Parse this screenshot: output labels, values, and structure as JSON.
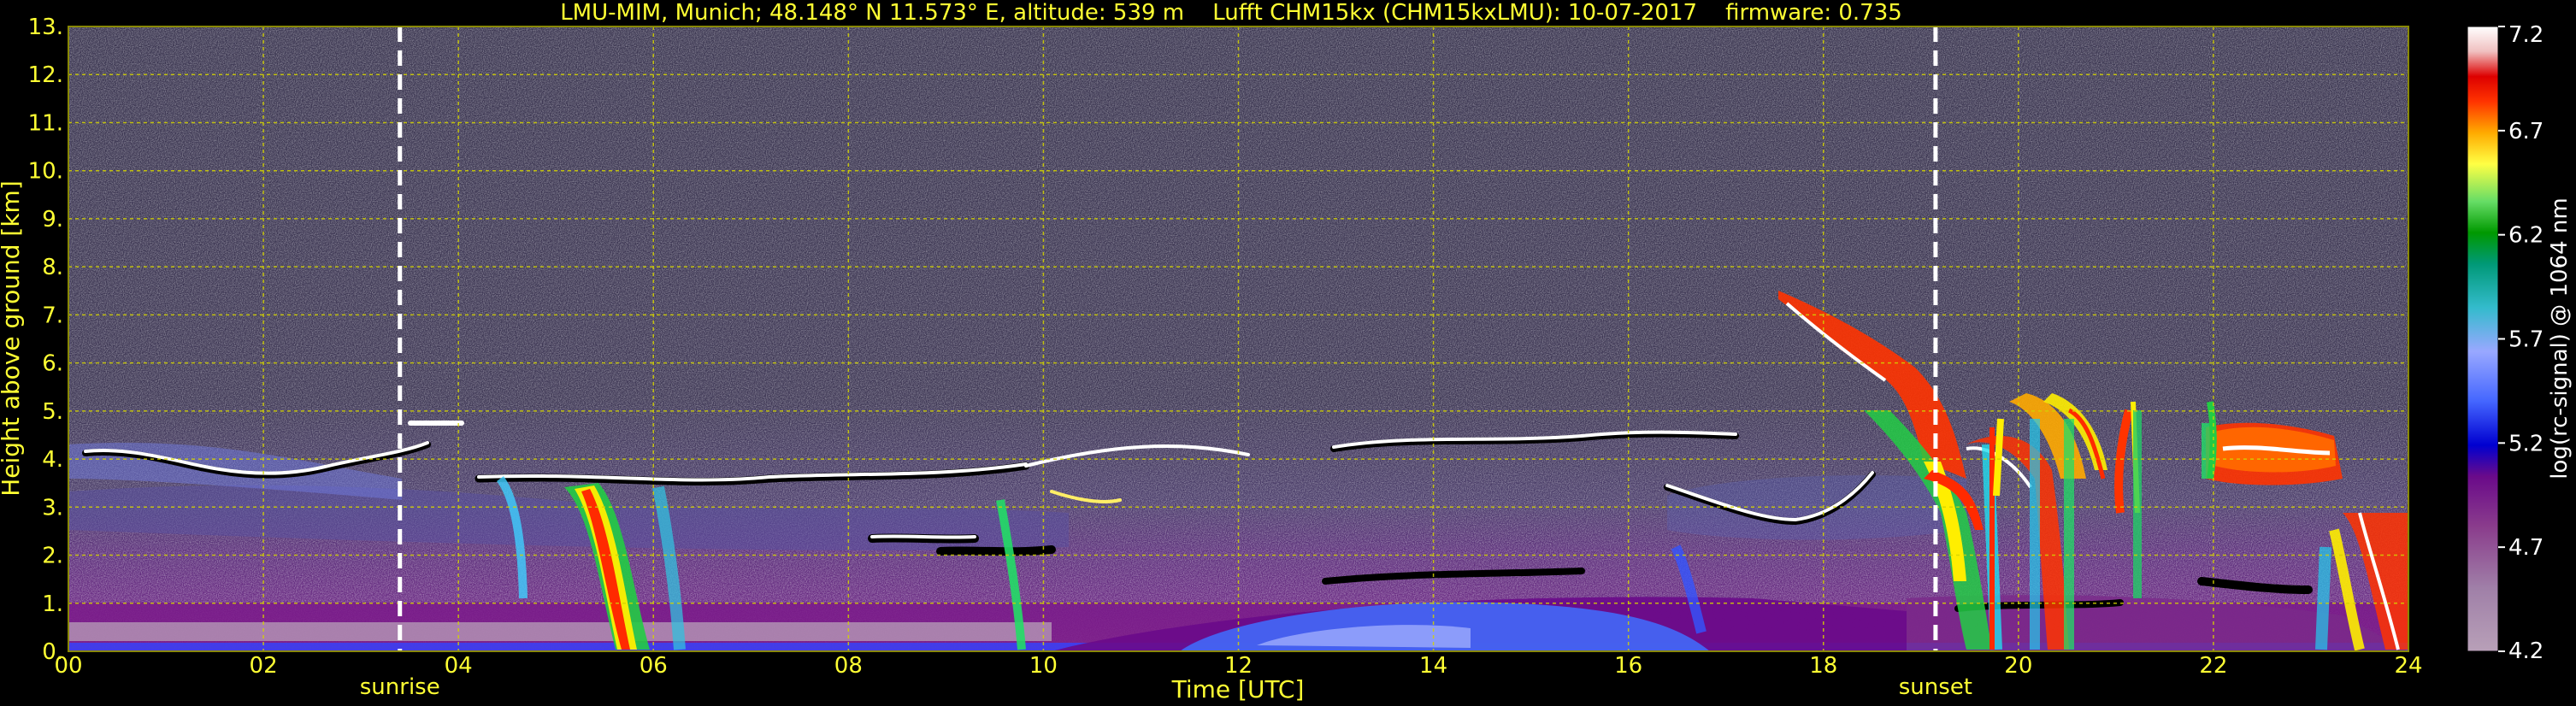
{
  "chart_data": {
    "type": "heatmap",
    "title": "LMU-MIM, Munich; 48.148° N 11.573° E, altitude: 539 m    Lufft CHM15kx (CHM15kxLMU): 10-07-2017    firmware: 0.735",
    "xlabel": "Time [UTC]",
    "ylabel": "Height above ground [km]",
    "xlim": [
      0,
      24
    ],
    "ylim": [
      0,
      13
    ],
    "x_ticks": [
      "00",
      "02",
      "04",
      "06",
      "08",
      "10",
      "12",
      "14",
      "16",
      "18",
      "20",
      "22",
      "24"
    ],
    "y_ticks": [
      "0.",
      "1.",
      "2.",
      "3.",
      "4.",
      "5.",
      "6.",
      "7.",
      "8.",
      "9.",
      "10.",
      "11.",
      "12.",
      "13."
    ],
    "grid": true,
    "events": [
      {
        "label": "sunrise",
        "time": 3.4
      },
      {
        "label": "sunset",
        "time": 19.15
      }
    ],
    "colorbar": {
      "label": "log(rc-signal) @ 1064 nm",
      "range": [
        4.2,
        7.2
      ],
      "ticks": [
        "4.2",
        "4.7",
        "5.2",
        "5.7",
        "6.2",
        "6.7",
        "7.2"
      ]
    }
  },
  "colors": {
    "axis_text": "#ffff33",
    "grid": "#d4d400",
    "event_line": "#ffffff",
    "background": "#000000"
  }
}
